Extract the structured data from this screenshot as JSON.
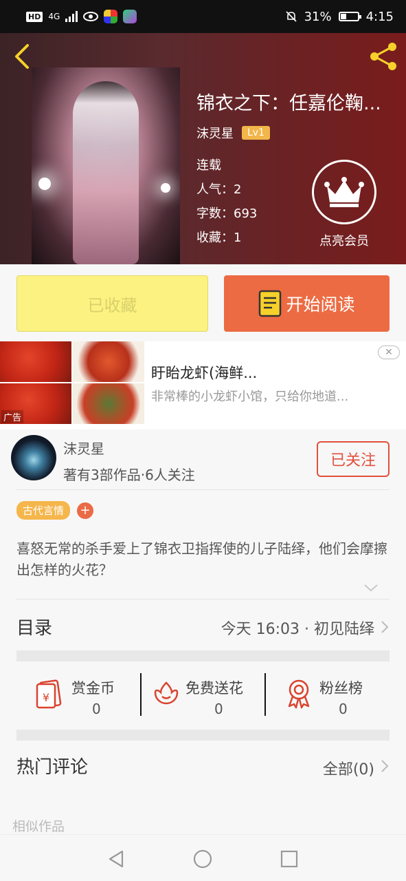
{
  "status_bar": {
    "hd": "HD",
    "network": "4G",
    "battery": "31%",
    "battery_level": 0.31,
    "time": "4:15"
  },
  "book": {
    "title": "锦衣之下：任嘉伦鞠...",
    "author": "沫灵星",
    "level": "Lv1",
    "status": "连载",
    "popularity": "人气：2",
    "word_count": "字数：693",
    "favorites": "收藏：1",
    "vip_label": "点亮会员"
  },
  "actions": {
    "favorited_label": "已收藏",
    "read_label": "开始阅读"
  },
  "ad": {
    "title": "盱眙龙虾(海鲜...",
    "description": "非常棒的小龙虾小馆，只给你地道...",
    "tag": "广告",
    "close": "✕"
  },
  "author_block": {
    "name": "沫灵星",
    "stats": "著有3部作品·6人关注",
    "follow_label": "已关注"
  },
  "tags": {
    "genre": "古代言情",
    "add": "+"
  },
  "synopsis": "喜怒无常的杀手爱上了锦衣卫指挥使的儿子陆绎，他们会摩擦出怎样的火花？",
  "toc": {
    "title": "目录",
    "latest": "今天 16:03 · 初见陆绎"
  },
  "stats": {
    "reward": {
      "label": "赏金币",
      "value": "0"
    },
    "flowers": {
      "label": "免费送花",
      "value": "0"
    },
    "fans": {
      "label": "粉丝榜",
      "value": "0"
    }
  },
  "comments": {
    "title": "热门评论",
    "all": "全部(0)"
  },
  "similar_title": "相似作品",
  "colors": {
    "accent_orange": "#ec6b43",
    "fav_yellow": "#fcf282",
    "tag_yellow": "#f5b64b",
    "follow_red": "#e1503c",
    "icon_yellow": "#f7d12b"
  }
}
